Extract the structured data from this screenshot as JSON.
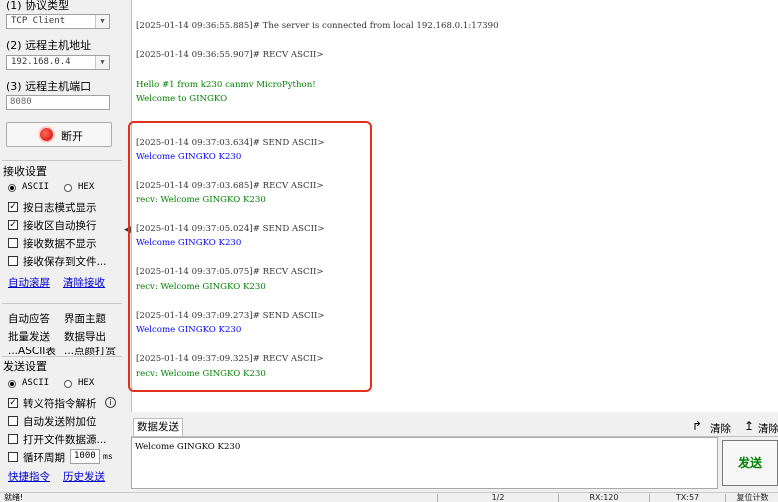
{
  "left": {
    "protocol": {
      "label": "(1) 协议类型",
      "value": "TCP Client"
    },
    "remote_host": {
      "label": "(2) 远程主机地址",
      "value": "192.168.0.4"
    },
    "remote_port": {
      "label": "(3) 远程主机端口",
      "value": "8080"
    },
    "disconnect_label": "断开",
    "receive_settings": {
      "title": "接收设置",
      "ascii": "ASCII",
      "hex": "HEX",
      "opt_log": "按日志模式显示",
      "opt_wrap": "接收区自动换行",
      "opt_hide": "接收数据不显示",
      "opt_save": "接收保存到文件...",
      "auto_scroll": "自动滚屏",
      "clear_recv": "清除接收"
    },
    "tools": {
      "auto_reply": "自动应答",
      "theme": "界面主题",
      "batch_send": "批量发送",
      "export": "数据导出",
      "cut_a": "...ASCII表",
      "cut_b": "...点颜打赏"
    },
    "send_settings": {
      "title": "发送设置",
      "ascii": "ASCII",
      "hex": "HEX",
      "opt_escape": "转义符指令解析",
      "opt_append": "自动发送附加位",
      "opt_file": "打开文件数据源...",
      "opt_cycle": "循环周期",
      "cycle_value": "1000",
      "cycle_unit": "ms",
      "shortcut": "快捷指令",
      "history": "历史发送"
    }
  },
  "log": [
    {
      "ts": "[2025-01-14 09:36:55.885]# The server is connected from local 192.168.0.1:17390",
      "msg": "",
      "color": "blue"
    },
    {
      "ts": "[2025-01-14 09:36:55.907]# RECV ASCII>",
      "msg": "",
      "color": "green"
    },
    {
      "ts": "",
      "msg": "Hello #1 from k230 canmv MicroPython!",
      "color": "green"
    },
    {
      "ts": "",
      "msg": "Welcome to GINGKO",
      "color": "green"
    },
    {
      "ts": "[2025-01-14 09:37:03.634]# SEND ASCII>",
      "msg": "Welcome GINGKO K230",
      "color": "blue"
    },
    {
      "ts": "[2025-01-14 09:37:03.685]# RECV ASCII>",
      "msg": "recv: Welcome GINGKO K230",
      "color": "green"
    },
    {
      "ts": "[2025-01-14 09:37:05.024]# SEND ASCII>",
      "msg": "Welcome GINGKO K230",
      "color": "blue"
    },
    {
      "ts": "[2025-01-14 09:37:05.075]# RECV ASCII>",
      "msg": "recv: Welcome GINGKO K230",
      "color": "green"
    },
    {
      "ts": "[2025-01-14 09:37:09.273]# SEND ASCII>",
      "msg": "Welcome GINGKO K230",
      "color": "blue"
    },
    {
      "ts": "[2025-01-14 09:37:09.325]# RECV ASCII>",
      "msg": "recv: Welcome GINGKO K230",
      "color": "green"
    }
  ],
  "send_area": {
    "tab": "数据发送",
    "clear": "清除",
    "clear2": "清除",
    "content": "Welcome GINGKO K230",
    "send_label": "发送"
  },
  "status": {
    "ready": "就绪!",
    "page": "1/2",
    "rx": "RX:120",
    "tx": "TX:57",
    "reset": "复位计数"
  },
  "colors": {
    "send": "#0000ff",
    "recv": "#008000",
    "highlight": "#e0301e"
  }
}
